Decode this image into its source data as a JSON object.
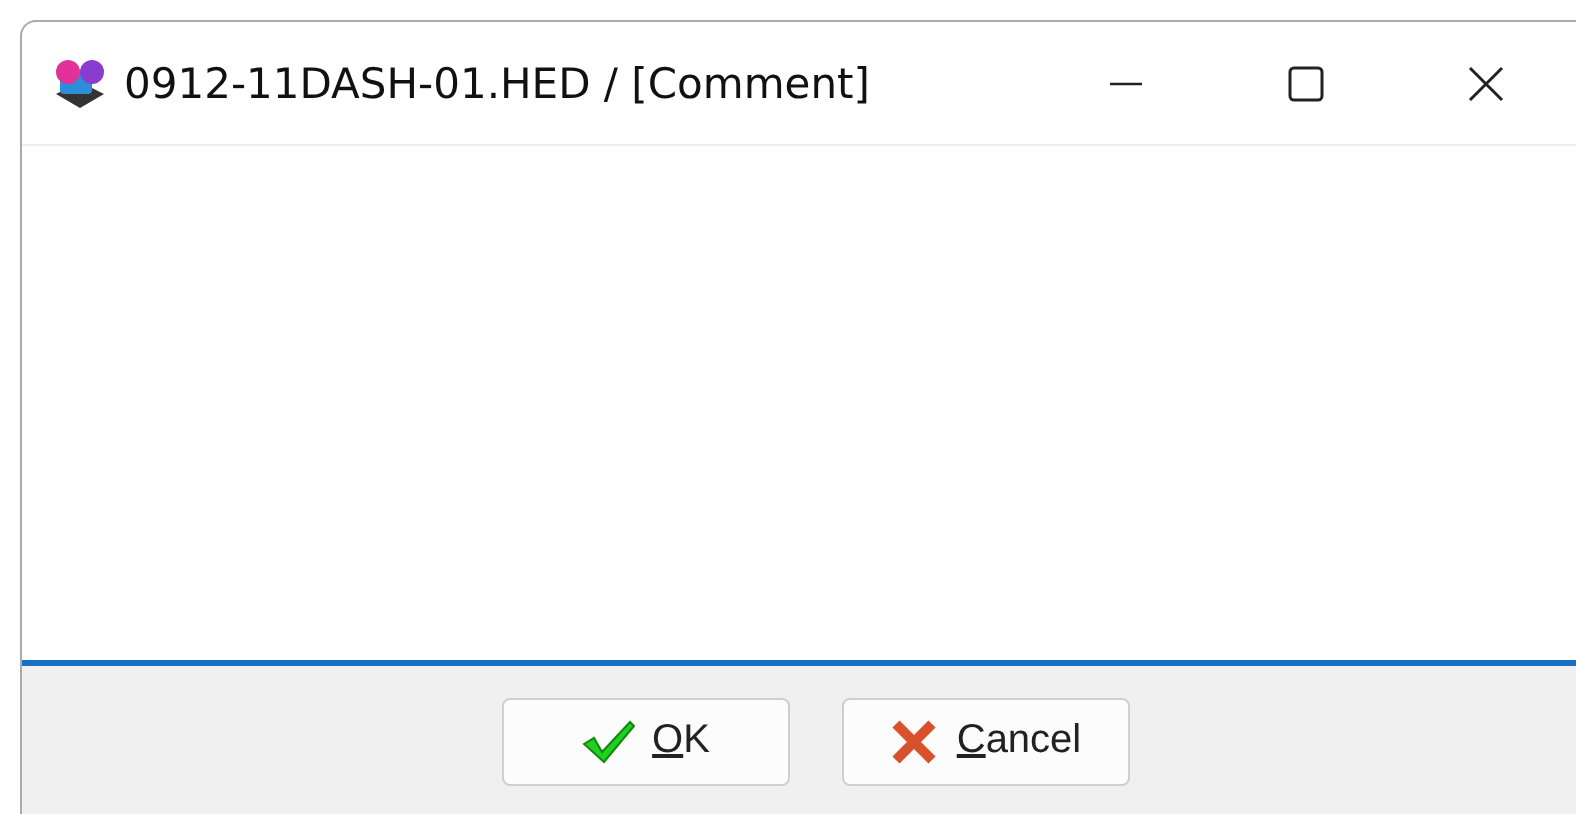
{
  "window": {
    "title": "0912-11DASH-01.HED / [Comment]"
  },
  "buttons": [
    {
      "kind": "ok",
      "access_key": "O",
      "label_rest": "K"
    },
    {
      "kind": "cancel",
      "access_key": "C",
      "label_rest": "ancel"
    }
  ]
}
